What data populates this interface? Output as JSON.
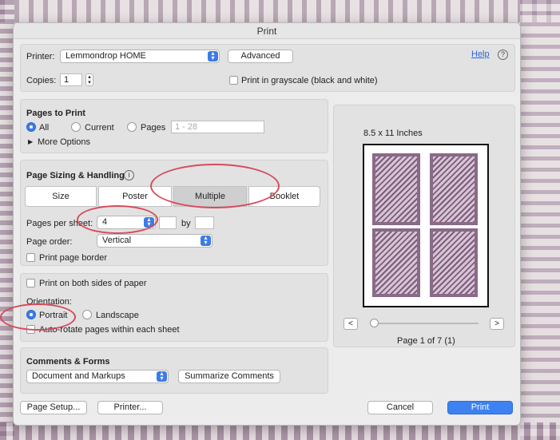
{
  "dialog": {
    "title": "Print"
  },
  "top": {
    "printer_label": "Printer:",
    "printer_value": "Lemmondrop HOME",
    "advanced": "Advanced",
    "help": "Help",
    "copies_label": "Copies:",
    "copies_value": "1",
    "grayscale": "Print in grayscale (black and white)"
  },
  "pages_to_print": {
    "title": "Pages to Print",
    "all": "All",
    "current": "Current",
    "pages": "Pages",
    "pages_placeholder": "1 - 28",
    "more_options": "More Options"
  },
  "sizing": {
    "title": "Page Sizing & Handling",
    "tabs": [
      "Size",
      "Poster",
      "Multiple",
      "Booklet"
    ],
    "selected_tab": "Multiple",
    "pages_per_sheet_label": "Pages per sheet:",
    "pages_per_sheet_value": "4",
    "by": "by",
    "page_order_label": "Page order:",
    "page_order_value": "Vertical",
    "print_border": "Print page border"
  },
  "orientation": {
    "both_sides": "Print on both sides of paper",
    "label": "Orientation:",
    "portrait": "Portrait",
    "landscape": "Landscape",
    "auto_rotate": "Auto-rotate pages within each sheet"
  },
  "comments": {
    "title": "Comments & Forms",
    "value": "Document and Markups",
    "summarize": "Summarize Comments"
  },
  "preview": {
    "paper": "8.5 x 11 Inches",
    "page_info": "Page 1 of 7 (1)",
    "prev": "<",
    "next": ">"
  },
  "bottom": {
    "page_setup": "Page Setup...",
    "printer": "Printer...",
    "cancel": "Cancel",
    "print": "Print"
  },
  "colors": {
    "accent": "#3d7be6",
    "annotation": "#d84a5c"
  }
}
